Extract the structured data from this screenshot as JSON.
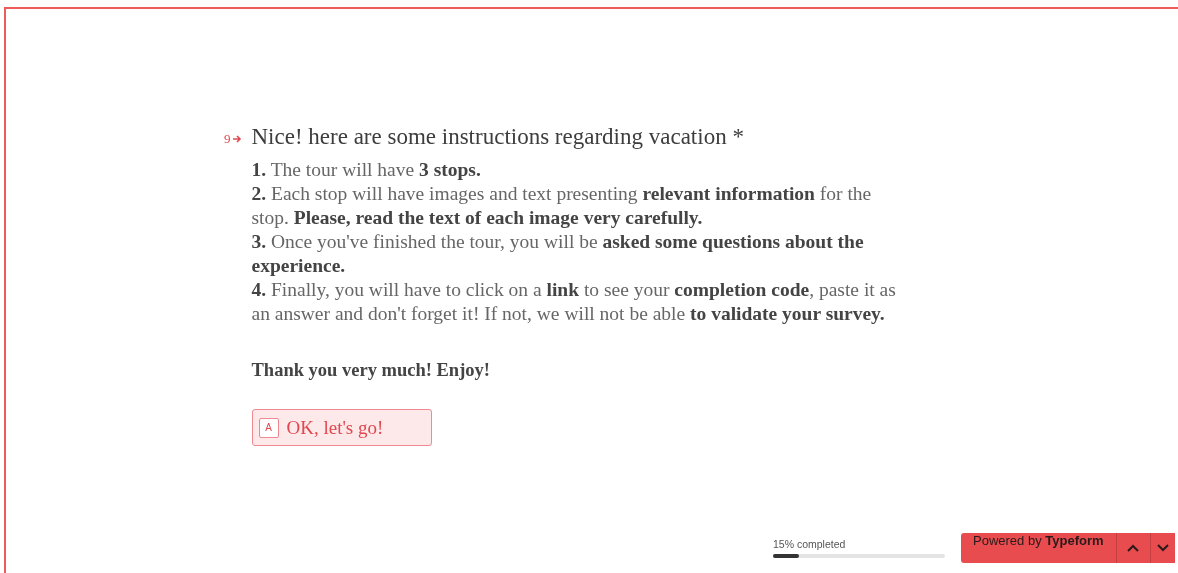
{
  "question": {
    "number": "9",
    "title": "Nice! here are some instructions regarding vacation *",
    "items": [
      "**1.** The tour will have **3 stops.**",
      "**2.** Each stop will have images and text presenting **relevant information** for the stop. **Please, read the text of each image very carefully.**",
      "**3.** Once you've finished the tour, you will be **asked some questions about the experience.**",
      "**4.** Finally, you will have to click on a **link** to see your **completion code**, paste it as an answer and don't forget it! If not, we will not be able **to validate your survey.**"
    ],
    "closing": "Thank you very much! Enjoy!",
    "button": {
      "key": "A",
      "label": "OK, let's go!"
    }
  },
  "progress": {
    "label": "15% completed",
    "level": 0.15
  },
  "footer": {
    "brand": "Powered by **Typeform**"
  }
}
